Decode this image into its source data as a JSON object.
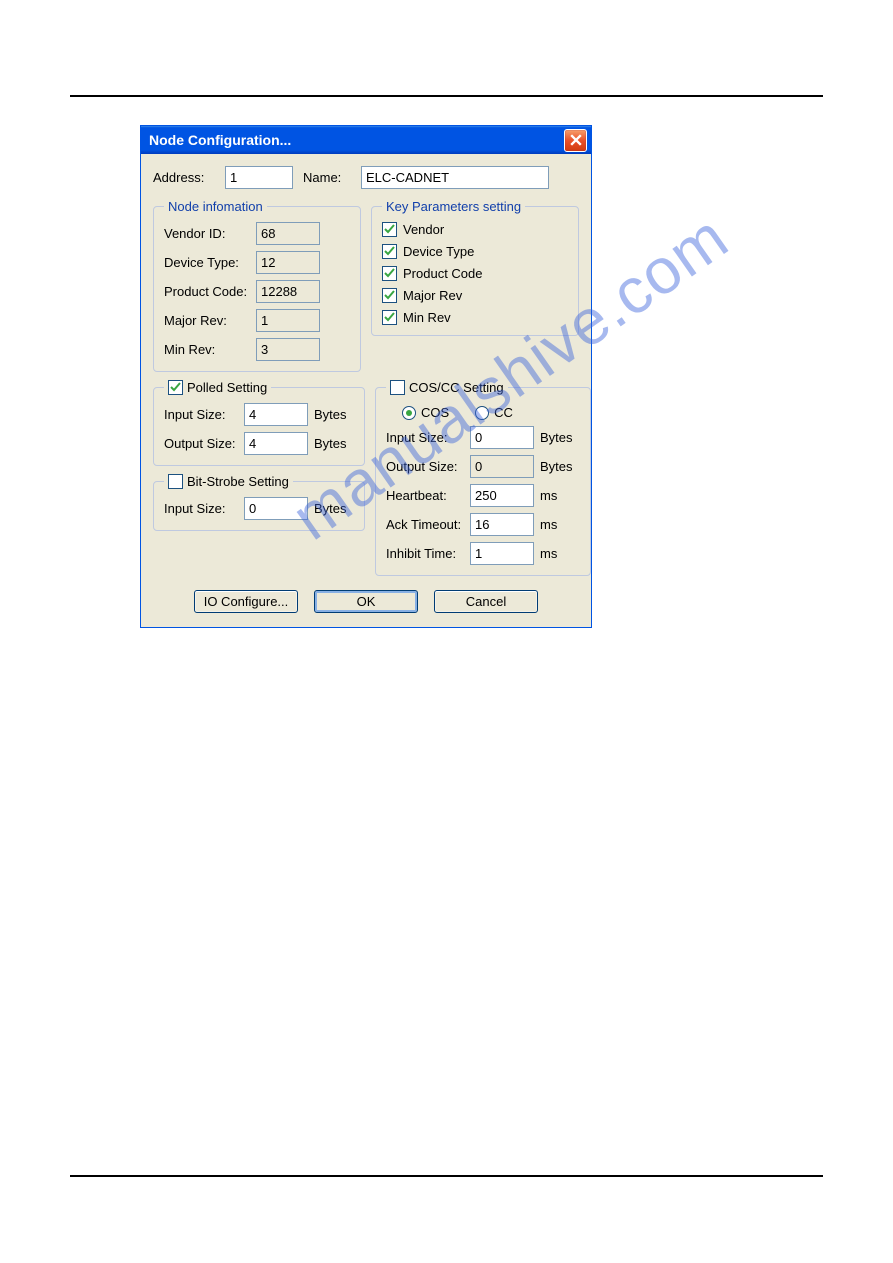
{
  "watermark": "manualshive.com",
  "dialog": {
    "title": "Node Configuration...",
    "address_label": "Address:",
    "address_value": "1",
    "name_label": "Name:",
    "name_value": "ELC-CADNET",
    "node_info": {
      "legend": "Node infomation",
      "rows": [
        {
          "label": "Vendor ID:",
          "value": "68"
        },
        {
          "label": "Device Type:",
          "value": "12"
        },
        {
          "label": "Product Code:",
          "value": "12288"
        },
        {
          "label": "Major Rev:",
          "value": "1"
        },
        {
          "label": "Min Rev:",
          "value": "3"
        }
      ]
    },
    "key_params": {
      "legend": "Key Parameters setting",
      "items": [
        {
          "label": "Vendor",
          "checked": true
        },
        {
          "label": "Device Type",
          "checked": true
        },
        {
          "label": "Product Code",
          "checked": true
        },
        {
          "label": "Major Rev",
          "checked": true
        },
        {
          "label": "Min Rev",
          "checked": true
        }
      ]
    },
    "polled": {
      "legend": "Polled Setting",
      "checked": true,
      "input_size_label": "Input Size:",
      "input_size_value": "4",
      "output_size_label": "Output Size:",
      "output_size_value": "4",
      "unit": "Bytes"
    },
    "bitstrobe": {
      "legend": "Bit-Strobe Setting",
      "checked": false,
      "input_size_label": "Input Size:",
      "input_size_value": "0",
      "unit": "Bytes"
    },
    "coscc": {
      "legend": "COS/CC Setting",
      "checked": false,
      "cos_label": "COS",
      "cc_label": "CC",
      "selected": "COS",
      "input_size_label": "Input Size:",
      "input_size_value": "0",
      "output_size_label": "Output Size:",
      "output_size_value": "0",
      "heartbeat_label": "Heartbeat:",
      "heartbeat_value": "250",
      "ack_timeout_label": "Ack Timeout:",
      "ack_timeout_value": "16",
      "inhibit_label": "Inhibit Time:",
      "inhibit_value": "1",
      "bytes": "Bytes",
      "ms": "ms"
    },
    "buttons": {
      "io_configure": "IO Configure...",
      "ok": "OK",
      "cancel": "Cancel"
    }
  }
}
